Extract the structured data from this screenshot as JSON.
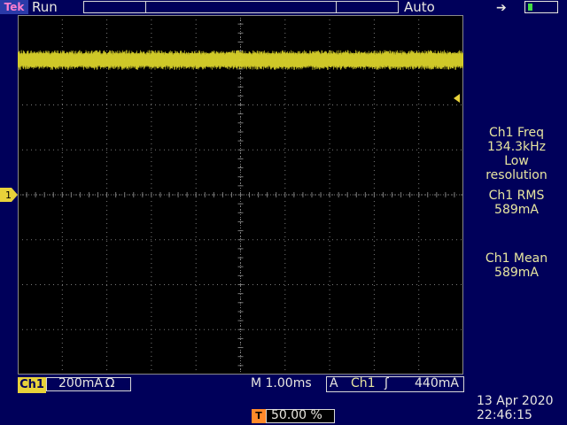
{
  "header": {
    "brand": "Tek",
    "status": "Run",
    "trigger_mode": "Auto"
  },
  "icons": {
    "power": "power-plug-icon",
    "battery": "battery-icon",
    "trigger_marker": "trigger-position-icon"
  },
  "colors": {
    "background": "#00005a",
    "graticule": "#000000",
    "trace": "#d8d22a",
    "trigger_accent": "#ff8a2a",
    "readout": "#e8e6a0"
  },
  "markers": {
    "trigger_label": "T",
    "ch1_label": "1"
  },
  "trace": {
    "channel": "Ch1",
    "level_div": 3.0,
    "noise_div": 0.22
  },
  "measurements": {
    "freq_label": "Ch1 Freq",
    "freq_value": "134.3kHz",
    "freq_note1": "Low",
    "freq_note2": "resolution",
    "rms_label": "Ch1 RMS",
    "rms_value": "589mA",
    "mean_label": "Ch1 Mean",
    "mean_value": "589mA"
  },
  "footer": {
    "ch1_badge": "Ch1",
    "ch1_scale": "200mA Ω",
    "timebase": "M 1.00ms",
    "trigger_type": "A",
    "trigger_source": "Ch1",
    "trigger_edge": "ʃ",
    "trigger_level": "440mA",
    "trigger_position_label": "T",
    "trigger_position": "50.00 %",
    "date": "13 Apr  2020",
    "time": "22:46:15"
  }
}
